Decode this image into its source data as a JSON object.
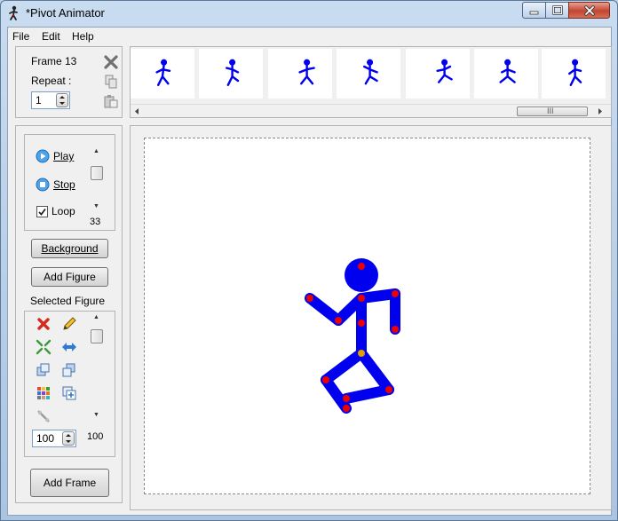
{
  "window": {
    "title": "*Pivot Animator"
  },
  "menu": {
    "file": "File",
    "edit": "Edit",
    "help": "Help"
  },
  "frame_panel": {
    "frame_label": "Frame 13",
    "repeat_label": "Repeat :",
    "repeat_value": "1"
  },
  "timeline": {
    "frame_count": 7,
    "scroll_thumb_glyph": "III"
  },
  "playback": {
    "play": "Play",
    "stop": "Stop",
    "loop": "Loop",
    "loop_checked": true,
    "speed_value": "33"
  },
  "buttons": {
    "background": "Background",
    "add_figure": "Add Figure",
    "add_frame": "Add Frame"
  },
  "selected_figure": {
    "label": "Selected Figure",
    "scale_value": "100",
    "side_value": "100"
  },
  "colors": {
    "figure": "#0000ee",
    "joint": "#ee0000",
    "joint_origin": "#e0a000",
    "canvas": "#ffffff"
  }
}
